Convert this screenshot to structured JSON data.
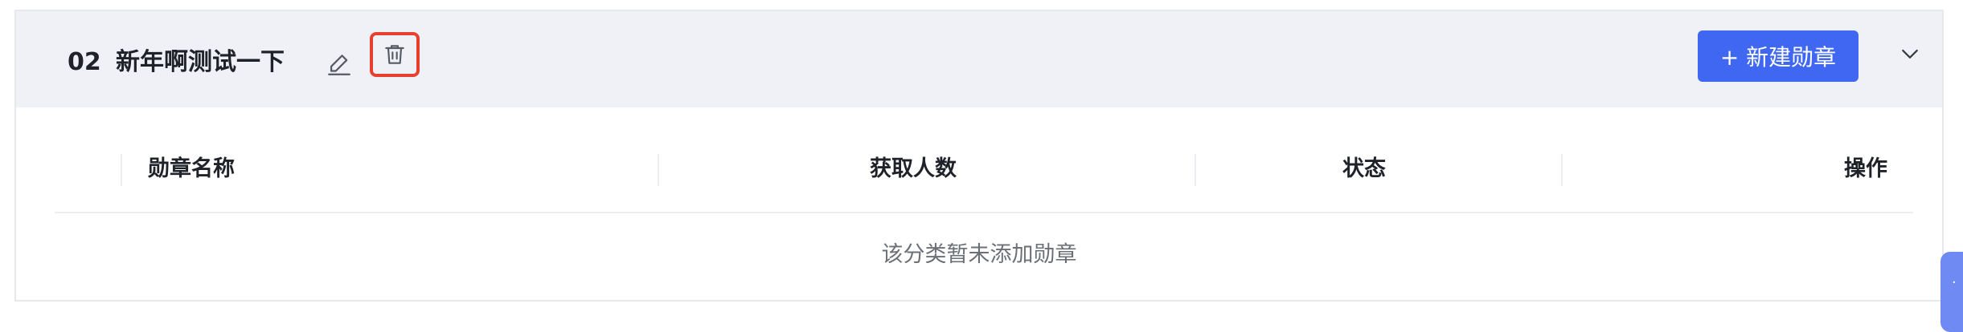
{
  "category": {
    "number": "02",
    "title": "新年啊测试一下"
  },
  "actions": {
    "new_badge_label": "+ 新建勋章"
  },
  "table": {
    "columns": [
      "勋章名称",
      "获取人数",
      "状态",
      "操作"
    ],
    "empty_message": "该分类暂未添加勋章"
  },
  "colors": {
    "accent": "#3f67f2",
    "highlight": "#e8402f",
    "header_bg": "#eff1f6"
  },
  "icons": [
    "edit-icon",
    "trash-icon",
    "chevron-down-icon"
  ]
}
